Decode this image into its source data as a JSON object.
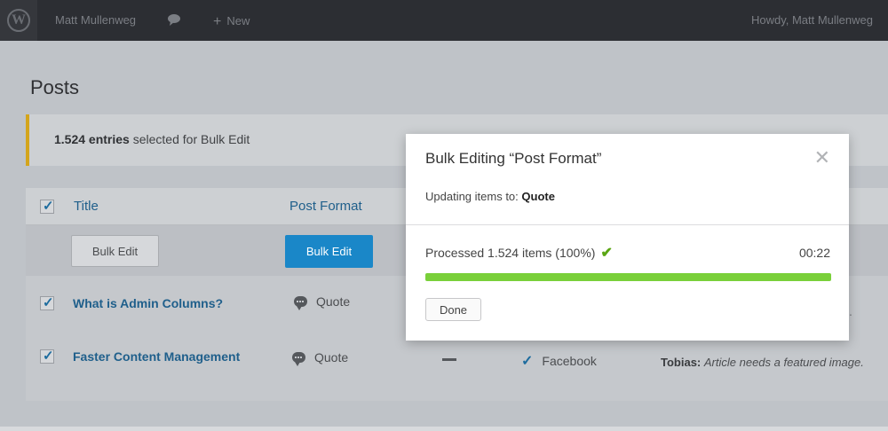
{
  "admin_bar": {
    "logo": "wordpress-logo",
    "user": "Matt Mullenweg",
    "comments_icon": "comment-bubble-icon",
    "new_label": "New",
    "howdy": "Howdy, Matt Mullenweg"
  },
  "page": {
    "title": "Posts"
  },
  "notice": {
    "count": "1.524 entries",
    "text": " selected for Bulk Edit"
  },
  "table": {
    "columns": {
      "title": "Title",
      "post_format": "Post Format"
    },
    "bulk_edit_label": "Bulk Edit",
    "rows": [
      {
        "title": "What is Admin Columns?",
        "format": "Quote"
      },
      {
        "title": "Faster Content Management",
        "format": "Quote",
        "social": "Facebook",
        "note_author": "Tobias:",
        "note_text": "Article needs a featured image."
      }
    ]
  },
  "modal": {
    "title": "Bulk Editing “Post Format”",
    "updating_prefix": "Updating items to: ",
    "updating_value": "Quote",
    "processed": "Processed 1.524 items (100%)",
    "timer": "00:22",
    "progress_percent": 100,
    "done_label": "Done",
    "trailing_dot": "."
  },
  "colors": {
    "accent": "#1a87c8",
    "progress": "#7ad03a",
    "notice_border": "#d4a51c"
  }
}
